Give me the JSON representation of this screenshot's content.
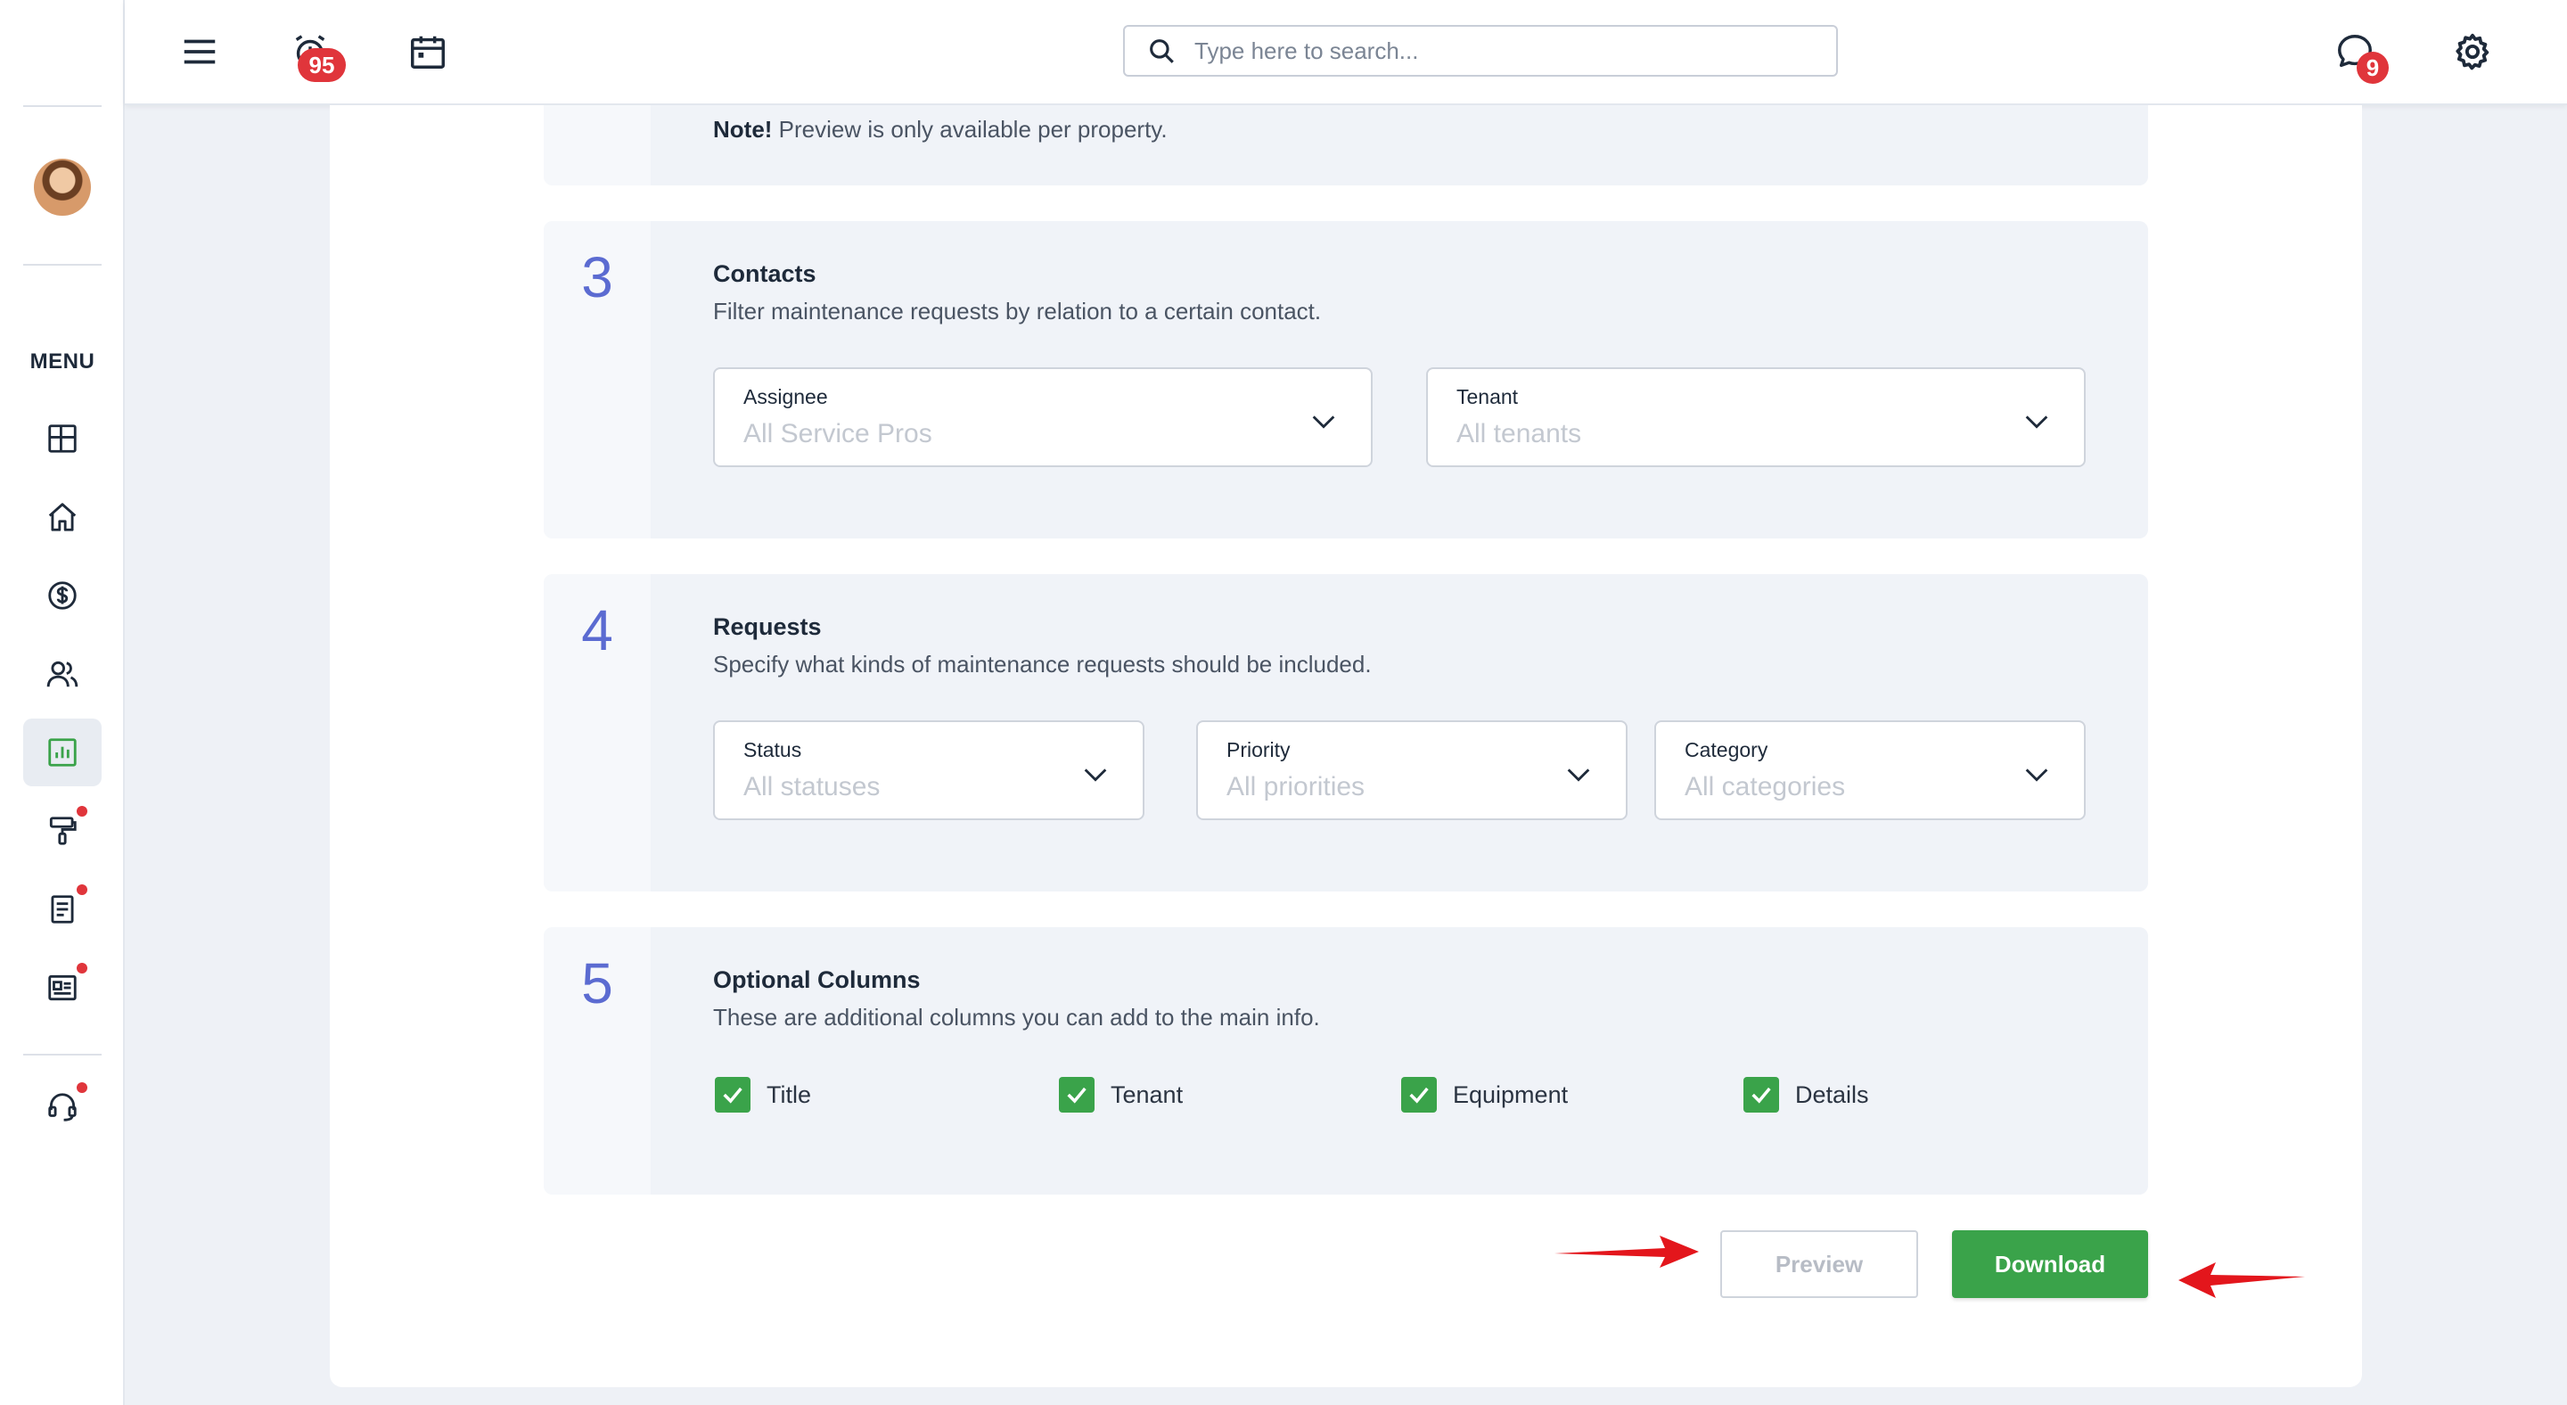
{
  "topbar": {
    "alarm_badge": "95",
    "chat_badge": "9",
    "search_placeholder": "Type here to search..."
  },
  "sidebar": {
    "menu_label": "MENU",
    "items": [
      {
        "icon": "dashboard-icon"
      },
      {
        "icon": "home-icon"
      },
      {
        "icon": "dollar-icon"
      },
      {
        "icon": "users-icon"
      },
      {
        "icon": "reports-icon",
        "active": true
      },
      {
        "icon": "maintenance-icon",
        "dot": true
      },
      {
        "icon": "document-icon",
        "dot": true
      },
      {
        "icon": "newspaper-icon",
        "dot": true
      },
      {
        "icon": "support-icon",
        "dot": true
      }
    ],
    "accent_color": "#3aa34a"
  },
  "note": {
    "bold": "Note!",
    "text": " Preview is only available per property."
  },
  "sections": {
    "contacts": {
      "number": "3",
      "title": "Contacts",
      "description": "Filter maintenance requests by relation to a certain contact.",
      "assignee": {
        "label": "Assignee",
        "value": "All Service Pros"
      },
      "tenant": {
        "label": "Tenant",
        "value": "All tenants"
      }
    },
    "requests": {
      "number": "4",
      "title": "Requests",
      "description": "Specify what kinds of maintenance requests should be included.",
      "status": {
        "label": "Status",
        "value": "All statuses"
      },
      "priority": {
        "label": "Priority",
        "value": "All priorities"
      },
      "category": {
        "label": "Category",
        "value": "All categories"
      }
    },
    "optional_columns": {
      "number": "5",
      "title": "Optional Columns",
      "description": "These are additional columns you can add to the main info.",
      "columns": [
        {
          "label": "Title",
          "checked": true
        },
        {
          "label": "Tenant",
          "checked": true
        },
        {
          "label": "Equipment",
          "checked": true
        },
        {
          "label": "Details",
          "checked": true
        }
      ]
    }
  },
  "actions": {
    "preview_label": "Preview",
    "download_label": "Download"
  },
  "colors": {
    "primary_green": "#3aa34a",
    "section_number": "#5b6bd1",
    "badge_red": "#e0353b",
    "annotation_arrow": "#e3161c"
  }
}
